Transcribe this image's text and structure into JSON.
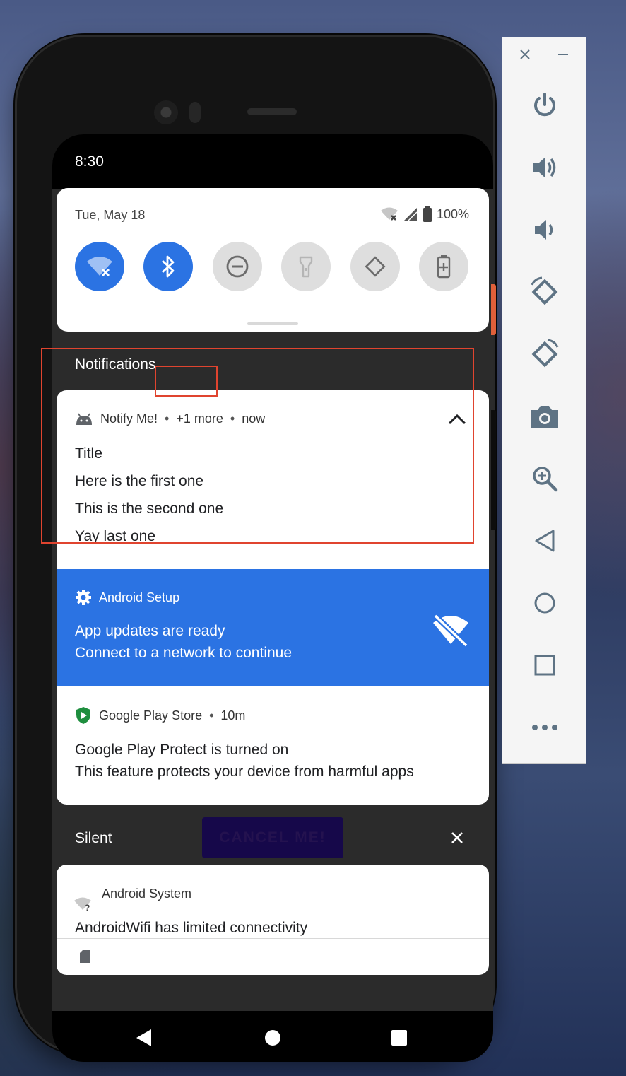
{
  "status_bar": {
    "time": "8:30"
  },
  "quick_settings": {
    "date": "Tue, May 18",
    "battery": "100%",
    "tiles": [
      {
        "name": "wifi-tile",
        "state": "on",
        "icon": "wifi-off-icon"
      },
      {
        "name": "bluetooth-tile",
        "state": "on",
        "icon": "bluetooth-icon"
      },
      {
        "name": "do-not-disturb-tile",
        "state": "off",
        "icon": "do-not-disturb-icon"
      },
      {
        "name": "flashlight-tile",
        "state": "off",
        "icon": "flashlight-icon"
      },
      {
        "name": "auto-rotate-tile",
        "state": "off",
        "icon": "auto-rotate-icon"
      },
      {
        "name": "battery-saver-tile",
        "state": "off",
        "icon": "battery-saver-icon"
      }
    ]
  },
  "notifications_section": {
    "title": "Notifications"
  },
  "notify_me": {
    "app": "Notify Me!",
    "more": "+1 more",
    "time": "now",
    "lines": [
      "Title",
      "Here is the first one",
      "This is the second one",
      "Yay last one"
    ]
  },
  "android_setup": {
    "app": "Android Setup",
    "title": "App updates are ready",
    "text": "Connect to a network to continue",
    "accent": "#2b73e3"
  },
  "play_store": {
    "app": "Google Play Store",
    "time": "10m",
    "title": "Google Play Protect is turned on",
    "text": "This feature protects your device from harmful apps"
  },
  "silent_section": {
    "title": "Silent"
  },
  "cancel_button": {
    "label": "CANCEL ME!"
  },
  "android_system": {
    "app": "Android System",
    "title": "AndroidWifi has limited connectivity"
  },
  "colors": {
    "highlight": "#e0442f",
    "tile_on": "#2b73e3",
    "toolbar_icon": "#5e7384"
  }
}
